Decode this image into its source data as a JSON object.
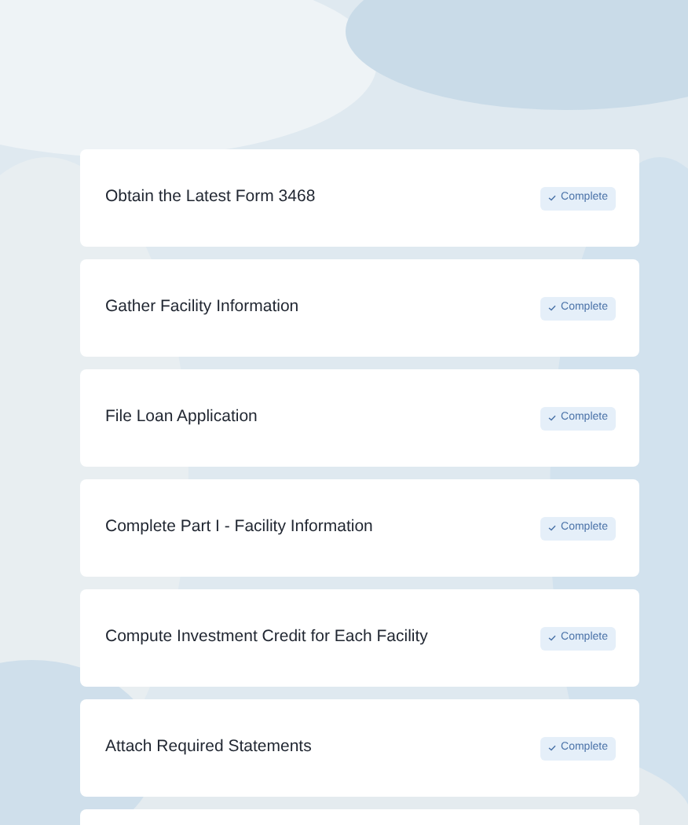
{
  "tasks": [
    {
      "title": "Obtain the Latest Form 3468",
      "status": "Complete",
      "done": true
    },
    {
      "title": "Gather Facility Information",
      "status": "Complete",
      "done": true
    },
    {
      "title": "File Loan Application",
      "status": "Complete",
      "done": true
    },
    {
      "title": "Complete Part I - Facility Information",
      "status": "Complete",
      "done": true
    },
    {
      "title": "Compute Investment Credit for Each Facility",
      "status": "Complete",
      "done": true
    },
    {
      "title": "Attach Required Statements",
      "status": "Complete",
      "done": true
    }
  ]
}
